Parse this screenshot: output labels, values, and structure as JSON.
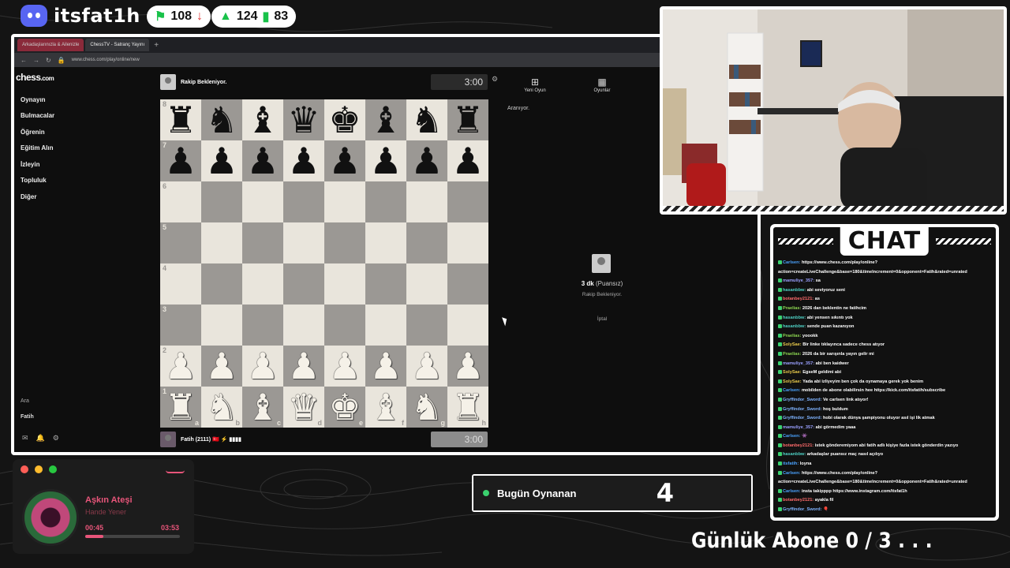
{
  "stream": {
    "channel": "itsfat1h",
    "stats": [
      {
        "value": "108",
        "icon": "flag-icon",
        "color": "#19c24a"
      },
      {
        "value": "124",
        "icon": "person-icon",
        "color": "#19c24a"
      },
      {
        "value": "83",
        "icon": "bars-icon",
        "color": "#19c24a"
      }
    ]
  },
  "browser": {
    "tabs": [
      "Arkadaşlarınızla & Ailenizle",
      "ChessTV - Satranç Yayını"
    ],
    "url": "www.chess.com/play/online/new"
  },
  "chesscom": {
    "logo": "chess",
    "logo_suffix": ".com",
    "nav": [
      "Oynayın",
      "Bulmacalar",
      "Öğrenin",
      "Eğitim Alın",
      "İzleyin",
      "Topluluk",
      "Diğer"
    ],
    "nav_bottom": [
      "Ara",
      "Fatih"
    ],
    "opponent_label": "Rakip Bekleniyor.",
    "top_clock": "3:00",
    "player_label": "Fatih (2111) 🇹🇷 ⚡ ▮▮▮▮",
    "bottom_clock": "3:00",
    "panel_tabs": [
      "Yeni Oyun",
      "Oyunlar"
    ],
    "searching": "Aranıyor.",
    "time_control": "3 dk",
    "rating_type": "(Puansız)",
    "waiting": "Rakip Bekleniyor.",
    "cancel": "İptal",
    "ranks": [
      "8",
      "7",
      "6",
      "5",
      "4",
      "3",
      "2",
      "1"
    ],
    "files": [
      "a",
      "b",
      "c",
      "d",
      "e",
      "f",
      "g",
      "h"
    ],
    "board": [
      [
        "bR",
        "bN",
        "bB",
        "bQ",
        "bK",
        "bB",
        "bN",
        "bR"
      ],
      [
        "bP",
        "bP",
        "bP",
        "bP",
        "bP",
        "bP",
        "bP",
        "bP"
      ],
      [
        "",
        "",
        "",
        "",
        "",
        "",
        "",
        ""
      ],
      [
        "",
        "",
        "",
        "",
        "",
        "",
        "",
        ""
      ],
      [
        "",
        "",
        "",
        "",
        "",
        "",
        "",
        ""
      ],
      [
        "",
        "",
        "",
        "",
        "",
        "",
        "",
        ""
      ],
      [
        "wP",
        "wP",
        "wP",
        "wP",
        "wP",
        "wP",
        "wP",
        "wP"
      ],
      [
        "wR",
        "wN",
        "wB",
        "wQ",
        "wK",
        "wB",
        "wN",
        "wR"
      ]
    ]
  },
  "chat": {
    "title": "CHAT",
    "messages": [
      {
        "user": "Carlsen:",
        "text": " https://www.chess.com/play/online?action=createLiveChallenge&base=180&timeIncrement=0&opponent=Fatih&rated=unrated",
        "color": "#4aa3ff"
      },
      {
        "user": "mamuliye_357:",
        "text": " sa",
        "color": "#9aa0ff"
      },
      {
        "user": "hasanbbw:",
        "text": " abi seviyoruz seni",
        "color": "#4fd1c5"
      },
      {
        "user": "botanbey2121:",
        "text": " as",
        "color": "#ff6b6b"
      },
      {
        "user": "Praelias:",
        "text": " 2026 dan beklentin ne fatihcim",
        "color": "#8bd450"
      },
      {
        "user": "hasanbbw:",
        "text": " abi yensen sıkıntı yok",
        "color": "#4fd1c5"
      },
      {
        "user": "hasanbbw:",
        "text": " sende puan kazanıyon",
        "color": "#4fd1c5"
      },
      {
        "user": "Praelias:",
        "text": " yoookk",
        "color": "#8bd450"
      },
      {
        "user": "SolySae:",
        "text": " Bir linke tıklayınca sadece chess atıyor",
        "color": "#e6c84a"
      },
      {
        "user": "Praelias:",
        "text": " 2026 da bir sarışınla yayın gelir mi",
        "color": "#8bd450"
      },
      {
        "user": "mamuliye_357:",
        "text": " abi ben kaidwer",
        "color": "#9aa0ff"
      },
      {
        "user": "SolySae:",
        "text": " EgseM geldimi abi",
        "color": "#e6c84a"
      },
      {
        "user": "SolySae:",
        "text": " Yada abi izliyeyim ben çok da oynamaya gerek yok benim",
        "color": "#e6c84a"
      },
      {
        "user": "Carlsen:",
        "text": " mobilden de abone olabilirsin hee https://kick.com/itsfatih/subscribe",
        "color": "#4aa3ff"
      },
      {
        "user": "Gryffindor_Sword:",
        "text": " Ve carlsen link atıyor!",
        "color": "#7fb3ff"
      },
      {
        "user": "Gryffindor_Sword:",
        "text": " hoş buldum",
        "color": "#7fb3ff"
      },
      {
        "user": "Gryffindor_Sword:",
        "text": " hobi olarak dünya şampiyonu oluyor asıl işi lik atmak",
        "color": "#7fb3ff"
      },
      {
        "user": "mamuliye_357:",
        "text": " abi görmedim yaaa",
        "color": "#9aa0ff"
      },
      {
        "user": "Carlsen:",
        "text": " 👾",
        "color": "#4aa3ff"
      },
      {
        "user": "botanbey2121:",
        "text": " istek gönderemiyom abi fatih adlı kişiye fazla istek gönderdin yazıyo",
        "color": "#ff6b6b"
      },
      {
        "user": "hasanbbw:",
        "text": " arkadaşlar puansız maç nasıl açılıyo",
        "color": "#4fd1c5"
      },
      {
        "user": "itsfatih:",
        "text": " loyna",
        "color": "#4aa3ff"
      },
      {
        "user": "Carlsen:",
        "text": " https://www.chess.com/play/online?action=createLiveChallenge&base=180&timeIncrement=0&opponent=Fatih&rated=unrated",
        "color": "#4aa3ff"
      },
      {
        "user": "Carlsen:",
        "text": " insta takipppp https://www.instagram.com/itsfat1h",
        "color": "#4aa3ff"
      },
      {
        "user": "botanbey2121:",
        "text": " ayakla fil",
        "color": "#ff6b6b"
      },
      {
        "user": "Gryffindor_Sword:",
        "text": " 🎈",
        "color": "#7fb3ff"
      }
    ]
  },
  "music": {
    "title": "Aşkın Ateşi",
    "artist": "Hande Yener",
    "elapsed": "00:45",
    "duration": "03:53",
    "progress": 0.19
  },
  "today": {
    "label": "Bugün Oynanan",
    "value": "4"
  },
  "subs_goal": "Günlük Abone  0 / 3 . . ."
}
